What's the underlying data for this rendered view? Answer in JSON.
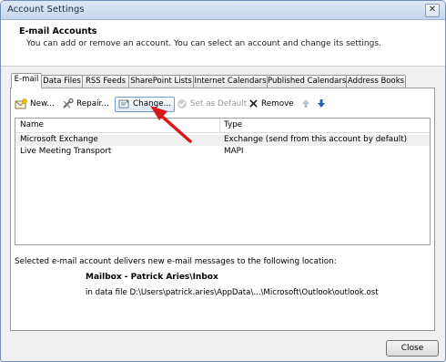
{
  "window": {
    "title": "Account Settings",
    "close_glyph": "✕"
  },
  "header": {
    "title": "E-mail Accounts",
    "description": "You can add or remove an account. You can select an account and change its settings."
  },
  "tabs": [
    {
      "label": "E-mail",
      "active": true
    },
    {
      "label": "Data Files"
    },
    {
      "label": "RSS Feeds"
    },
    {
      "label": "SharePoint Lists"
    },
    {
      "label": "Internet Calendars"
    },
    {
      "label": "Published Calendars"
    },
    {
      "label": "Address Books"
    }
  ],
  "toolbar": {
    "new_label": "New...",
    "repair_label": "Repair...",
    "change_label": "Change...",
    "default_label": "Set as Default",
    "remove_label": "Remove"
  },
  "accounts": {
    "columns": [
      "Name",
      "Type"
    ],
    "rows": [
      {
        "name": "Microsoft Exchange",
        "type": "Exchange (send from this account by default)",
        "selected": true
      },
      {
        "name": "Live Meeting Transport",
        "type": "MAPI"
      }
    ]
  },
  "delivery": {
    "text": "Selected e-mail account delivers new e-mail messages to the following location:",
    "mailbox": "Mailbox - Patrick Aries\\Inbox",
    "data_file": "in data file D:\\Users\\patrick.aries\\AppData\\...\\Microsoft\\Outlook\\outlook.ost"
  },
  "footer": {
    "close_label": "Close"
  },
  "colors": {
    "arrow": "#d81818",
    "accent": "#2b5fb4"
  }
}
